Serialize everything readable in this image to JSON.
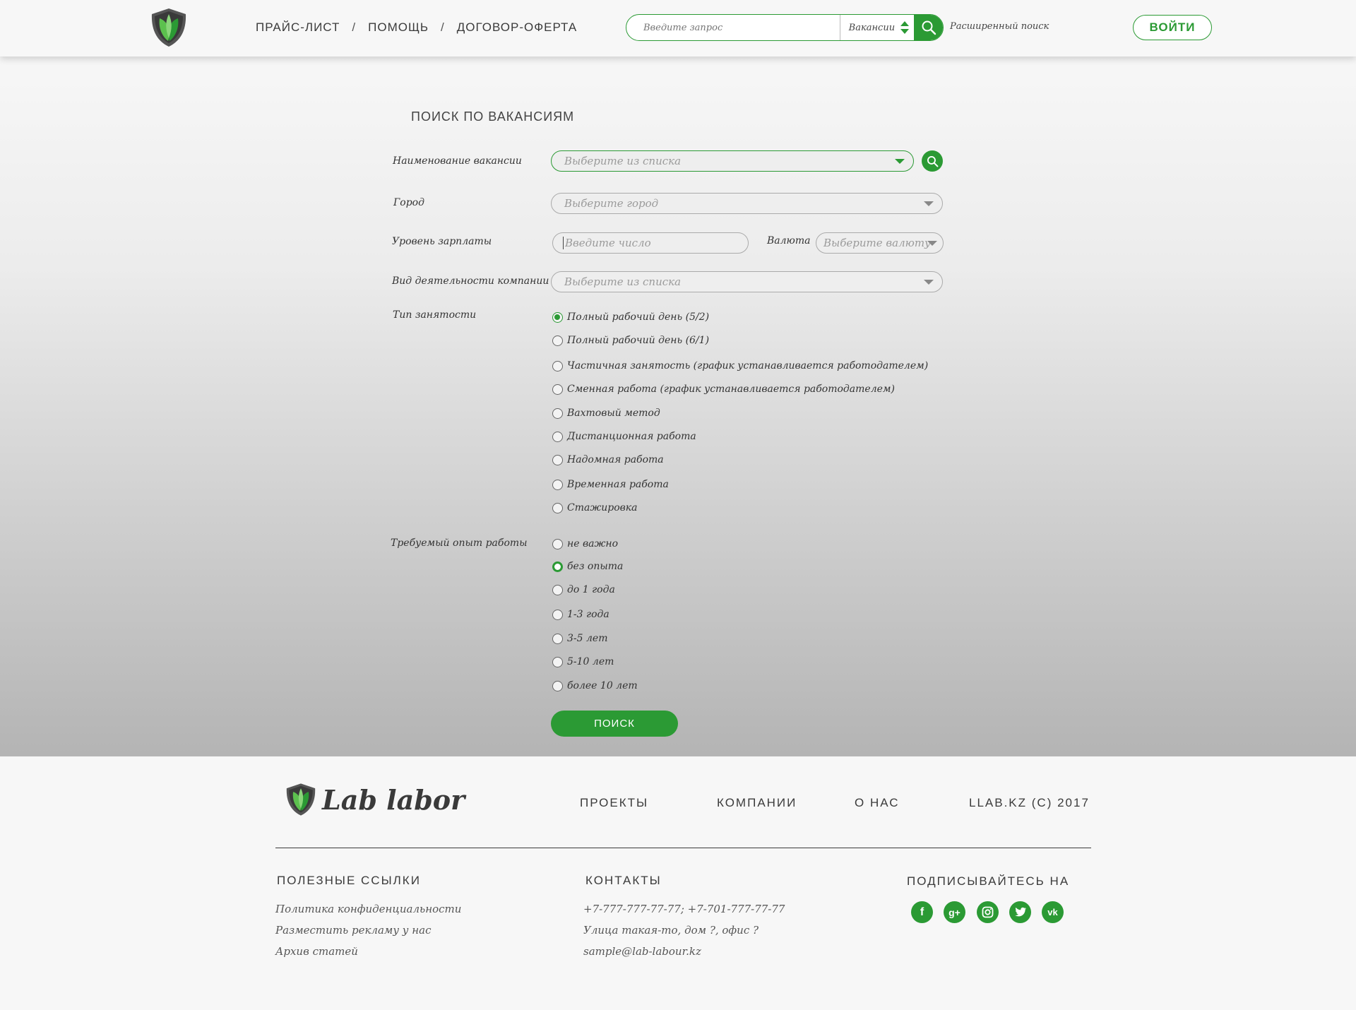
{
  "header": {
    "nav": [
      "ПРАЙС-ЛИСТ",
      "ПОМОЩЬ",
      "ДОГОВОР-ОФЕРТА"
    ],
    "nav_sep": "/",
    "search_placeholder": "Введите запрос",
    "search_category": "Вакансии",
    "advanced_search": "Расширенный поиск",
    "login": "ВОЙТИ"
  },
  "form": {
    "title": "ПОИСК ПО ВАКАНСИЯМ",
    "vacancy_label": "Наименование вакансии",
    "vacancy_placeholder": "Выберите из списка",
    "city_label": "Город",
    "city_placeholder": "Выберите город",
    "salary_label": "Уровень зарплаты",
    "salary_placeholder": "Введите число",
    "currency_label": "Валюта",
    "currency_placeholder": "Выберите валюту",
    "activity_label": "Вид деятельности компании",
    "activity_placeholder": "Выберите из списка",
    "employment_label": "Тип занятости",
    "employment_options": [
      "Полный рабочий день (5/2)",
      "Полный рабочий день (6/1)",
      "Частичная занятость (график устанавливается работодателем)",
      "Сменная работа (график устанавливается работодателем)",
      "Вахтовый метод",
      "Дистанционная работа",
      "Надомная работа",
      "Временная работа",
      "Стажировка"
    ],
    "employment_selected": 0,
    "experience_label": "Требуемый опыт работы",
    "experience_options": [
      "не важно",
      "без опыта",
      "до 1 года",
      "1-3 года",
      "3-5 лет",
      "5-10 лет",
      "более 10 лет"
    ],
    "experience_selected": 1,
    "submit": "ПОИСК"
  },
  "footer": {
    "brand": "Lab labor",
    "nav": [
      "ПРОЕКТЫ",
      "КОМПАНИИ",
      "О НАС",
      "LLAB.KZ (C) 2017"
    ],
    "useful_title": "ПОЛЕЗНЫЕ ССЫЛКИ",
    "useful_links": [
      "Политика конфиденциальности",
      "Разместить рекламу у нас",
      "Архив статей"
    ],
    "contacts_title": "КОНТАКТЫ",
    "contacts": [
      "+7-777-777-77-77; +7-701-777-77-77",
      "Улица такая-то, дом ?, офис ?",
      "sample@lab-labour.kz"
    ],
    "subscribe_title": "ПОДПИСЫВАЙТЕСЬ НА",
    "social": [
      "facebook-icon",
      "google-plus-icon",
      "instagram-icon",
      "twitter-icon",
      "vk-icon"
    ]
  },
  "colors": {
    "accent": "#2b9a34"
  }
}
